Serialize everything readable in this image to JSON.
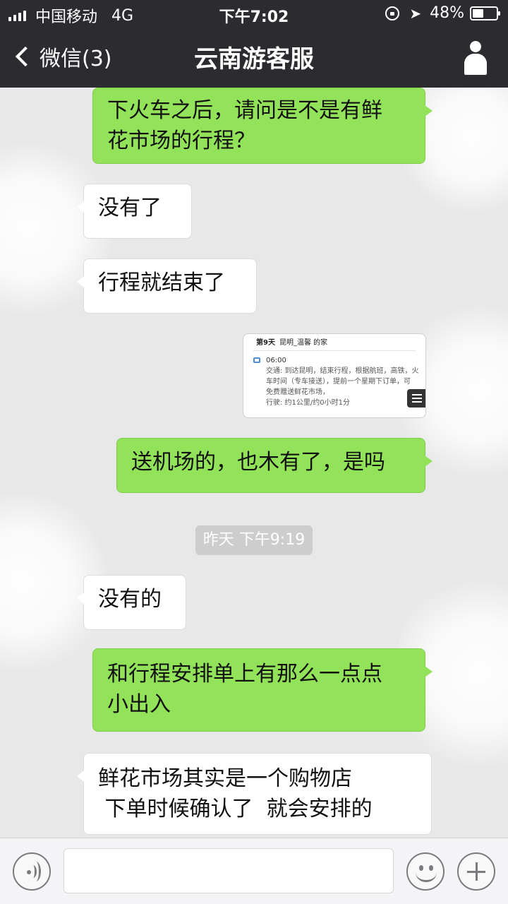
{
  "status_bar": {
    "carrier": "中国移动",
    "network": "4G",
    "time": "下午7:02",
    "battery_percent": "48%",
    "battery_level": 0.48
  },
  "nav": {
    "back_label": "微信(3)",
    "title": "云南游客服"
  },
  "messages": [
    {
      "side": "right",
      "lines": [
        "下火车之后，请问是不是有鲜",
        "花市场的行程？"
      ]
    },
    {
      "side": "left",
      "lines": [
        "没有了"
      ]
    },
    {
      "side": "left",
      "lines": [
        "行程就结束了"
      ]
    },
    {
      "side": "right",
      "lines": [
        "送机场的，也木有了，是吗"
      ]
    },
    {
      "side": "left",
      "lines": [
        "没有的"
      ]
    },
    {
      "side": "right",
      "lines": [
        "和行程安排单上有那么一点点",
        "小出入"
      ]
    },
    {
      "side": "left",
      "lines": [
        "鲜花市场其实是一个购物店",
        " 下单时候确认了  就会安排的"
      ]
    }
  ],
  "image_message": {
    "day": "第9天",
    "place": "昆明_温馨 的家",
    "time": "06:00",
    "detail_lines": [
      "交通: 到达昆明，结束行程，根据航班，高铁，火",
      "车时间（专车接送），提前一个星期下订单，可",
      "免费赠送鲜花市场，",
      "行驶: 约1公里/约0小时1分"
    ]
  },
  "timestamp": "昨天 下午9:19"
}
